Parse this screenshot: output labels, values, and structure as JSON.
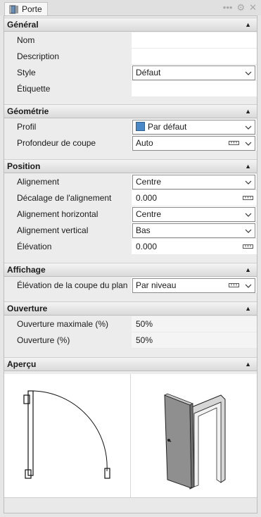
{
  "tab": {
    "title": "Porte",
    "icon": "door-icon"
  },
  "tools": {
    "more": "•••",
    "settings": "⚙",
    "close": "✕"
  },
  "icons": {
    "collapse": "▲",
    "chevron": "chevron-down-icon",
    "ruler": "ruler-icon"
  },
  "sections": {
    "general": {
      "title": "Général",
      "rows": [
        {
          "label": "Nom",
          "value": ""
        },
        {
          "label": "Description",
          "value": ""
        },
        {
          "label": "Style",
          "value": "Défaut"
        },
        {
          "label": "Étiquette",
          "value": ""
        }
      ]
    },
    "geometry": {
      "title": "Géométrie",
      "rows": [
        {
          "label": "Profil",
          "value": "Par défaut"
        },
        {
          "label": "Profondeur de coupe",
          "value": "Auto"
        }
      ]
    },
    "position": {
      "title": "Position",
      "rows": [
        {
          "label": "Alignement",
          "value": "Centre"
        },
        {
          "label": "Décalage de l'alignement",
          "value": "0.000"
        },
        {
          "label": "Alignement horizontal",
          "value": "Centre"
        },
        {
          "label": "Alignement vertical",
          "value": "Bas"
        },
        {
          "label": "Élévation",
          "value": "0.000"
        }
      ]
    },
    "display": {
      "title": "Affichage",
      "rows": [
        {
          "label": "Élévation de la coupe du plan",
          "value": "Par niveau"
        }
      ]
    },
    "opening": {
      "title": "Ouverture",
      "rows": [
        {
          "label": "Ouverture maximale (%)",
          "value": "50%"
        },
        {
          "label": "Ouverture (%)",
          "value": "50%"
        }
      ]
    },
    "preview": {
      "title": "Aperçu"
    }
  },
  "colors": {
    "profile_swatch": "#4a89c8",
    "header_bg": "#e4e4e4",
    "panel_bg": "#ececec"
  }
}
